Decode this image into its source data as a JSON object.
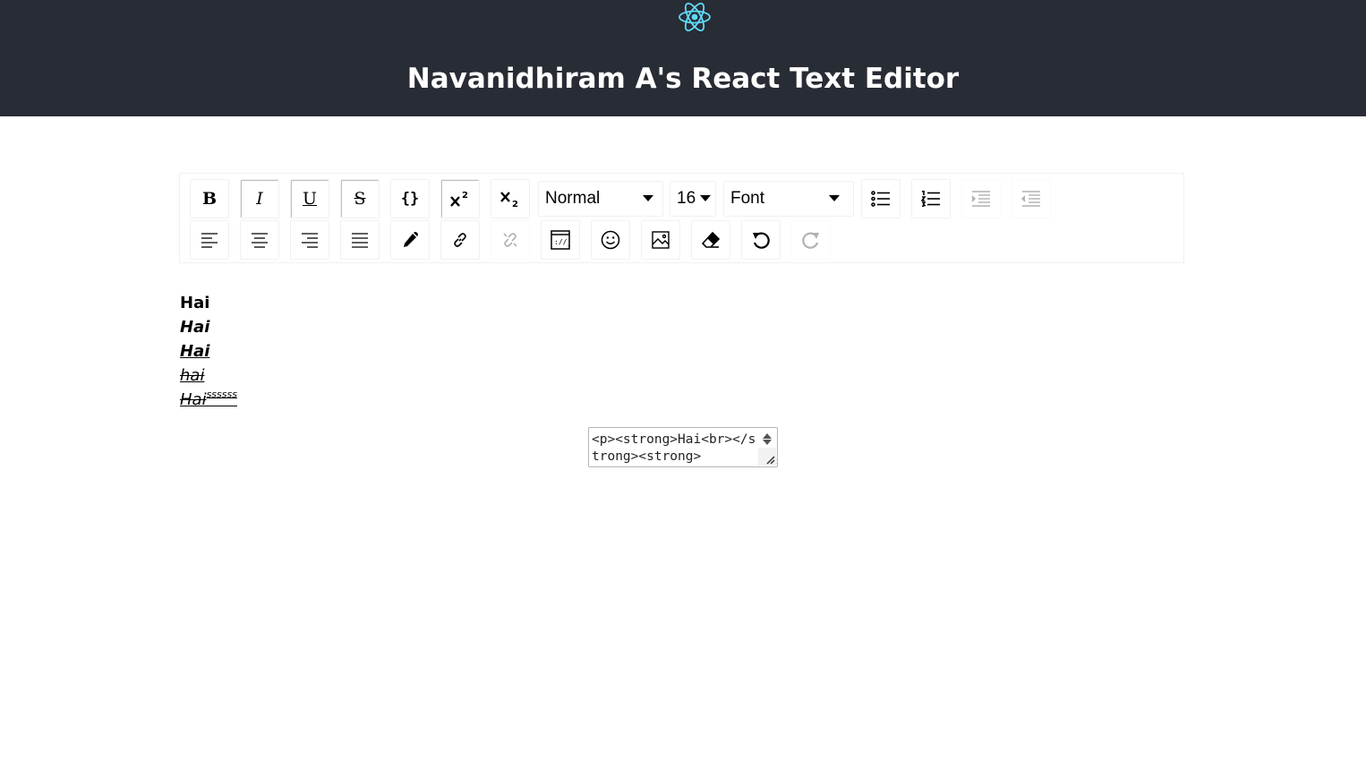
{
  "header": {
    "logo_icon": "react-logo-icon",
    "title": "Navanidhiram A's React Text Editor",
    "background": "#282c34",
    "logo_color": "#61dafb"
  },
  "toolbar": {
    "row1": {
      "bold": {
        "label": "B",
        "icon": "bold-icon",
        "active": false
      },
      "italic": {
        "label": "I",
        "icon": "italic-icon",
        "active": true
      },
      "underline": {
        "label": "U",
        "icon": "underline-icon",
        "active": true
      },
      "strikethrough": {
        "label": "S",
        "icon": "strikethrough-icon",
        "active": true
      },
      "code": {
        "label": "{}",
        "icon": "code-icon",
        "active": false
      },
      "superscript": {
        "icon": "superscript-icon",
        "active": true
      },
      "subscript": {
        "icon": "subscript-icon",
        "active": false
      },
      "block_type": {
        "value": "Normal"
      },
      "font_size": {
        "value": "16"
      },
      "font_family": {
        "value": "Font"
      },
      "unordered_list": {
        "icon": "unordered-list-icon"
      },
      "ordered_list": {
        "icon": "ordered-list-icon"
      },
      "indent": {
        "icon": "indent-icon",
        "disabled": true
      },
      "outdent": {
        "icon": "outdent-icon",
        "disabled": true
      }
    },
    "row2": {
      "align_left": {
        "icon": "align-left-icon"
      },
      "align_center": {
        "icon": "align-center-icon"
      },
      "align_right": {
        "icon": "align-right-icon"
      },
      "align_justify": {
        "icon": "align-justify-icon"
      },
      "color_picker": {
        "icon": "color-picker-icon"
      },
      "link": {
        "icon": "link-icon"
      },
      "unlink": {
        "icon": "unlink-icon",
        "disabled": true
      },
      "embedded": {
        "icon": "embedded-icon"
      },
      "emoji": {
        "icon": "emoji-icon"
      },
      "image": {
        "icon": "image-icon"
      },
      "remove_formatting": {
        "icon": "eraser-icon"
      },
      "undo": {
        "icon": "undo-icon"
      },
      "redo": {
        "icon": "redo-icon",
        "disabled": true
      }
    }
  },
  "editor": {
    "lines": [
      {
        "text": "Hai",
        "style": "bold"
      },
      {
        "text": "Hai",
        "style": "bold-italic"
      },
      {
        "text": "Hai",
        "style": "bold-italic-underline"
      },
      {
        "text": "hai",
        "style": "italic-underline-strikethrough"
      },
      {
        "text": "Hai",
        "style": "italic-underline-strikethrough",
        "sup": "ssssss"
      }
    ]
  },
  "html_output": {
    "value": "<p><strong>Hai<br></strong><strong>"
  }
}
